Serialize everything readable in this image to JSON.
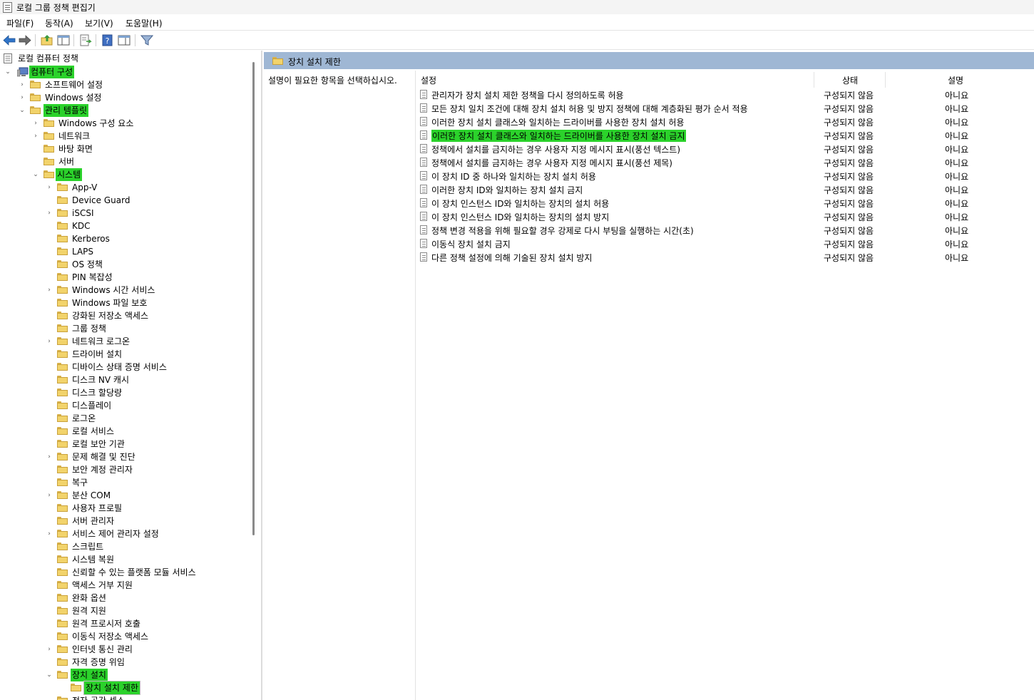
{
  "window": {
    "title": "로컬 그룹 정책 편집기"
  },
  "menu": {
    "file": "파일(F)",
    "action": "동작(A)",
    "view": "보기(V)",
    "help": "도움말(H)"
  },
  "toolbar": {
    "icons": [
      "back-arrow-icon",
      "forward-arrow-icon",
      "up-folder-icon",
      "show-hide-tree-icon",
      "export-list-icon",
      "help-icon",
      "properties-pane-icon",
      "filter-icon"
    ]
  },
  "tree": {
    "root": "로컬 컴퓨터 정책",
    "computer_config": "컴퓨터 구성",
    "software_settings": "소프트웨어 설정",
    "windows_settings": "Windows 설정",
    "admin_templates": "관리 템플릿",
    "windows_components": "Windows 구성 요소",
    "network": "네트워크",
    "desktop": "바탕 화면",
    "server": "서버",
    "system": "시스템",
    "system_items": [
      "App-V",
      "Device Guard",
      "iSCSI",
      "KDC",
      "Kerberos",
      "LAPS",
      "OS 정책",
      "PIN 복잡성",
      "Windows 시간 서비스",
      "Windows 파일 보호",
      "강화된 저장소 액세스",
      "그룹 정책",
      "네트워크 로그온",
      "드라이버 설치",
      "디바이스 상태 증명 서비스",
      "디스크 NV 캐시",
      "디스크 할당량",
      "디스플레이",
      "로그온",
      "로컬 서비스",
      "로컬 보안 기관",
      "문제 해결 및 진단",
      "보안 계정 관리자",
      "복구",
      "분산 COM",
      "사용자 프로필",
      "서버 관리자",
      "서비스 제어 관리자 설정",
      "스크립트",
      "시스템 복원",
      "신뢰할 수 있는 플랫폼 모듈 서비스",
      "액세스 거부 지원",
      "완화 옵션",
      "원격 지원",
      "원격 프로시저 호출",
      "이동식 저장소 액세스",
      "인터넷 통신 관리",
      "자격 증명 위임",
      "장치 설치",
      "장치 설치 제한",
      "전자 공간 센스"
    ]
  },
  "right": {
    "header_title": "장치 설치 제한",
    "description": "설명이 필요한 항목을 선택하십시오.",
    "columns": {
      "setting": "설정",
      "state": "상태",
      "comment": "설명"
    },
    "rows": [
      {
        "name": "관리자가 장치 설치 제한 정책을 다시 정의하도록 허용",
        "state": "구성되지 않음",
        "comment": "아니요"
      },
      {
        "name": "모든 장치 일치 조건에 대해 장치 설치 허용 및 방지 정책에 대해 계층화된 평가 순서 적용",
        "state": "구성되지 않음",
        "comment": "아니요"
      },
      {
        "name": "이러한 장치 설치 클래스와 일치하는 드라이버를 사용한 장치 설치 허용",
        "state": "구성되지 않음",
        "comment": "아니요"
      },
      {
        "name": "이러한 장치 설치 클래스와 일치하는 드라이버를 사용한 장치 설치 금지",
        "state": "구성되지 않음",
        "comment": "아니요"
      },
      {
        "name": "정책에서 설치를 금지하는 경우 사용자 지정 메시지 표시(풍선 텍스트)",
        "state": "구성되지 않음",
        "comment": "아니요"
      },
      {
        "name": "정책에서 설치를 금지하는 경우 사용자 지정 메시지 표시(풍선 제목)",
        "state": "구성되지 않음",
        "comment": "아니요"
      },
      {
        "name": "이 장치 ID 중 하나와 일치하는 장치 설치 허용",
        "state": "구성되지 않음",
        "comment": "아니요"
      },
      {
        "name": "이러한 장치 ID와 일치하는 장치 설치 금지",
        "state": "구성되지 않음",
        "comment": "아니요"
      },
      {
        "name": "이 장치 인스턴스 ID와 일치하는 장치의 설치 허용",
        "state": "구성되지 않음",
        "comment": "아니요"
      },
      {
        "name": "이 장치 인스턴스 ID와 일치하는 장치의 설치 방지",
        "state": "구성되지 않음",
        "comment": "아니요"
      },
      {
        "name": "정책 변경 적용을 위해 필요할 경우 강제로 다시 부팅을 실행하는 시간(초)",
        "state": "구성되지 않음",
        "comment": "아니요"
      },
      {
        "name": "이동식 장치 설치 금지",
        "state": "구성되지 않음",
        "comment": "아니요"
      },
      {
        "name": "다른 정책 설정에 의해 기술된 장치 설치 방지",
        "state": "구성되지 않음",
        "comment": "아니요"
      }
    ]
  }
}
